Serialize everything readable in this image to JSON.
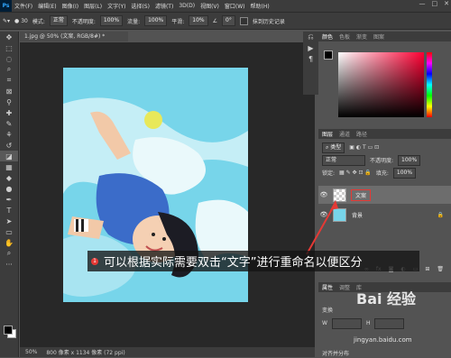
{
  "menubar": {
    "logo": "Ps",
    "items": [
      "文件(F)",
      "编辑(E)",
      "图像(I)",
      "图层(L)",
      "文字(Y)",
      "选择(S)",
      "滤镜(T)",
      "3D(D)",
      "视图(V)",
      "窗口(W)",
      "帮助(H)"
    ],
    "window_buttons": [
      "—",
      "□",
      "✕"
    ]
  },
  "options_bar": {
    "brush_size": "30",
    "mode_label": "模式:",
    "mode_value": "正常",
    "opacity_label": "不透明度:",
    "opacity_value": "100%",
    "flow_label": "流量:",
    "flow_value": "100%",
    "smooth_label": "平滑:",
    "smooth_value": "10%",
    "angle_value": "0°",
    "erase_history_label": "抹到历史记录"
  },
  "document": {
    "tab_title": "1.jpg @ 50% (文案, RGB/8#) *",
    "zoom": "50%",
    "size_info": "800 像素 x 1134 像素 (72 ppi)"
  },
  "color_panel": {
    "tabs": [
      "颜色",
      "色板",
      "渐变",
      "图案"
    ]
  },
  "layers_panel": {
    "tabs": [
      "图层",
      "通道",
      "路径"
    ],
    "kind_label": "类型",
    "blend_mode": "正常",
    "opacity_label": "不透明度:",
    "opacity_value": "100%",
    "lock_label": "锁定:",
    "fill_label": "填充:",
    "fill_value": "100%",
    "layers": [
      {
        "name": "文案"
      },
      {
        "name": "背景"
      }
    ]
  },
  "properties_panel": {
    "tabs": [
      "属性",
      "调整",
      "库"
    ],
    "section": "变换",
    "w_label": "W",
    "h_label": "H",
    "w_value": "",
    "h_value": "",
    "align_section": "对齐并分布"
  },
  "annotation": {
    "number": "1",
    "text": "可以根据实际需要双击“文字”进行重命名以便区分"
  },
  "watermark": {
    "brand": "Bai 经验",
    "url": "jingyan.baidu.com"
  },
  "colors": {
    "accent_red": "#e53935",
    "ui_dark": "#3c3c3c",
    "ui_mid": "#535353"
  }
}
